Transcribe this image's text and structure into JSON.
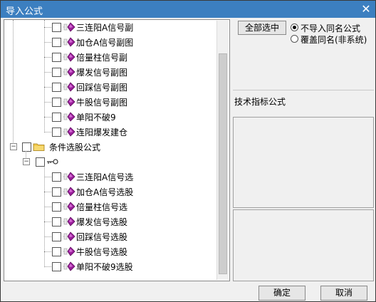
{
  "window": {
    "title": "导入公式",
    "close_glyph": "✕"
  },
  "tree": {
    "group_a_items": [
      {
        "label": "三连阳A信号副"
      },
      {
        "label": "加仓A信号副图"
      },
      {
        "label": "倍量柱信号副"
      },
      {
        "label": "爆发信号副图"
      },
      {
        "label": "回踩信号副图"
      },
      {
        "label": "牛股信号副图"
      },
      {
        "label": "单阳不破9"
      },
      {
        "label": "连阳爆发建仓"
      }
    ],
    "folder_label": "条件选股公式",
    "key_node_label": "",
    "group_b_items": [
      {
        "label": "三连阳A信号选"
      },
      {
        "label": "加仓A信号选股"
      },
      {
        "label": "倍量柱信号选"
      },
      {
        "label": "爆发信号选股"
      },
      {
        "label": "回踩信号选股"
      },
      {
        "label": "牛股信号选股"
      },
      {
        "label": "单阳不破9选股"
      }
    ]
  },
  "options": {
    "select_all_label": "全部选中",
    "radio_skip_label": "不导入同名公式",
    "radio_overwrite_label": "覆盖同名(非系统)",
    "selected": "skip"
  },
  "info": {
    "section_label": "技术指标公式"
  },
  "buttons": {
    "ok_label": "确定",
    "cancel_label": "取消"
  },
  "colors": {
    "titlebar": "#3c7fc0",
    "formula_icon": "#9b1f9b",
    "folder": "#f2c94c"
  }
}
